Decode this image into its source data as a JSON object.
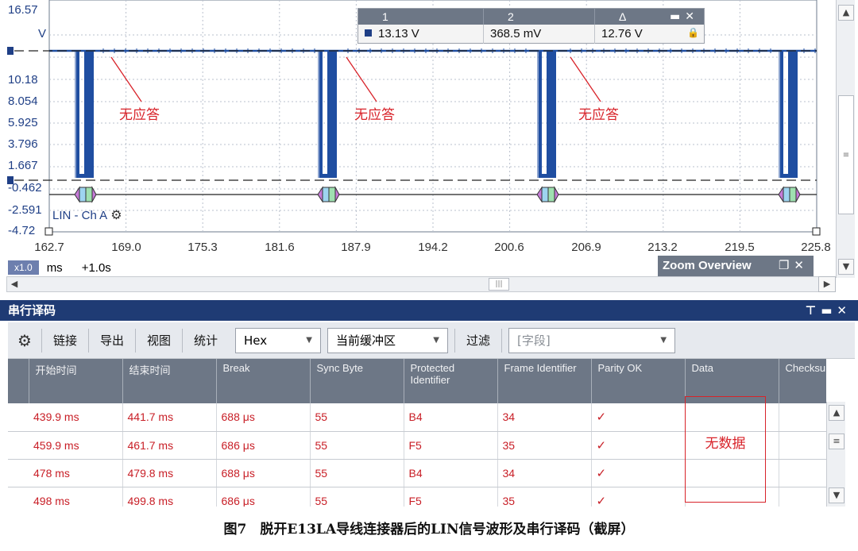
{
  "scope": {
    "y_axis_unit_top": "16.57",
    "y_axis_unit": "V",
    "y_ticks": [
      "10.18",
      "8.054",
      "5.925",
      "3.796",
      "1.667",
      "-0.462",
      "-2.591",
      "-4.72"
    ],
    "x_ticks": [
      "162.7",
      "169.0",
      "175.3",
      "181.6",
      "187.9",
      "194.2",
      "200.6",
      "206.9",
      "213.2",
      "219.5",
      "225.8"
    ],
    "annotations": [
      "无应答",
      "无应答",
      "无应答"
    ],
    "channel_label": "LIN - Ch A",
    "wave_color": "#1f4ea1",
    "annotation_color": "#d8232a",
    "time_scale": "x1.0",
    "time_unit": "ms",
    "time_offset": "+1.0s",
    "zoom_overview_title": "Zoom Overview",
    "measurement": {
      "headers": [
        "1",
        "2",
        "Δ"
      ],
      "values": [
        "13.13 V",
        "368.5 mV",
        "12.76 V"
      ]
    }
  },
  "decode": {
    "panel_title": "串行译码",
    "toolbar": {
      "link": "链接",
      "export": "导出",
      "view": "视图",
      "stats": "统计",
      "format": "Hex",
      "buffer": "当前缓冲区",
      "filter": "过滤",
      "field_placeholder": "[字段]"
    },
    "columns": [
      "开始时间",
      "结束时间",
      "Break",
      "Sync Byte",
      "Protected Identifier",
      "Frame Identifier",
      "Parity OK",
      "Data",
      "Checksu"
    ],
    "rows": [
      [
        "439.9 ms",
        "441.7 ms",
        "688 μs",
        "55",
        "B4",
        "34",
        "✓",
        "",
        ""
      ],
      [
        "459.9 ms",
        "461.7 ms",
        "686 μs",
        "55",
        "F5",
        "35",
        "✓",
        "",
        ""
      ],
      [
        "478 ms",
        "479.8 ms",
        "688 μs",
        "55",
        "B4",
        "34",
        "✓",
        "",
        ""
      ],
      [
        "498 ms",
        "499.8 ms",
        "686 μs",
        "55",
        "F5",
        "35",
        "✓",
        "",
        ""
      ]
    ],
    "no_data_note": "无数据"
  },
  "caption": "图7　脱开E13LA导线连接器后的LIN信号波形及串行译码（截屏）"
}
